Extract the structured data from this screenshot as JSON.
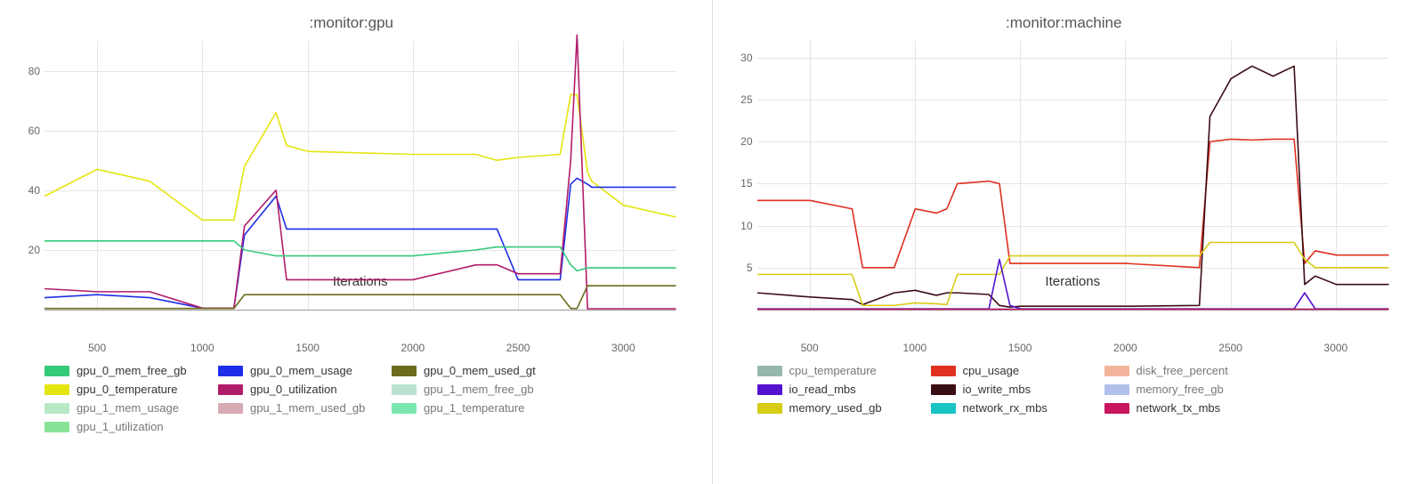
{
  "chart_data": [
    {
      "type": "line",
      "title": ":monitor:gpu",
      "xlabel": "Iterations",
      "ylabel": "",
      "xlim": [
        250,
        3250
      ],
      "ylim": [
        0,
        90
      ],
      "x": [
        250,
        500,
        750,
        1000,
        1150,
        1200,
        1350,
        1400,
        1500,
        2000,
        2300,
        2400,
        2500,
        2700,
        2750,
        2780,
        2830,
        2850,
        3000,
        3250
      ],
      "x_ticks": [
        500,
        1000,
        1500,
        2000,
        2500,
        3000
      ],
      "y_ticks": [
        20,
        40,
        60,
        80
      ],
      "legend_items": [
        {
          "name": "gpu_0_mem_free_gb",
          "color": "#35c97a",
          "active": true
        },
        {
          "name": "gpu_0_mem_usage",
          "color": "#1e2ee8",
          "active": true
        },
        {
          "name": "gpu_0_mem_used_gt",
          "color": "#6b6b1a",
          "active": true
        },
        {
          "name": "gpu_0_temperature",
          "color": "#e4e410",
          "active": true
        },
        {
          "name": "gpu_0_utilization",
          "color": "#b11c6a",
          "active": true
        },
        {
          "name": "gpu_1_mem_free_gb",
          "color": "#b8e2cf",
          "active": false
        },
        {
          "name": "gpu_1_mem_usage",
          "color": "#b8e8c5",
          "active": false
        },
        {
          "name": "gpu_1_mem_used_gb",
          "color": "#d8abb4",
          "active": false
        },
        {
          "name": "gpu_1_temperature",
          "color": "#7ce6b0",
          "active": false
        },
        {
          "name": "gpu_1_utilization",
          "color": "#88e396",
          "active": false
        }
      ],
      "series": [
        {
          "name": "gpu_0_temperature",
          "color": "#e4e410",
          "values": [
            38,
            47,
            43,
            30,
            30,
            48,
            66,
            55,
            53,
            52,
            52,
            50,
            51,
            52,
            72,
            72,
            46,
            43,
            35,
            31
          ]
        },
        {
          "name": "gpu_0_mem_usage",
          "color": "#1e2ee8",
          "values": [
            4,
            5,
            4,
            0.5,
            0.5,
            25,
            38,
            27,
            27,
            27,
            27,
            27,
            10,
            10,
            42,
            44,
            42,
            41,
            41,
            41
          ]
        },
        {
          "name": "gpu_0_utilization",
          "color": "#b11c6a",
          "values": [
            7,
            6,
            6,
            0.5,
            0.5,
            28,
            40,
            10,
            10,
            10,
            15,
            15,
            12,
            12,
            50,
            92,
            0.3,
            0.3,
            0.3,
            0.3
          ]
        },
        {
          "name": "gpu_0_mem_free_gb",
          "color": "#35c97a",
          "values": [
            23,
            23,
            23,
            23,
            23,
            20,
            18,
            18,
            18,
            18,
            20,
            21,
            21,
            21,
            15,
            13,
            14,
            14,
            14,
            14
          ]
        },
        {
          "name": "gpu_0_mem_used_gt",
          "color": "#6b6b1a",
          "values": [
            0.4,
            0.4,
            0.4,
            0.4,
            0.4,
            5,
            5,
            5,
            5,
            5,
            5,
            5,
            5,
            5,
            0.4,
            0.4,
            8,
            8,
            8,
            8
          ]
        }
      ]
    },
    {
      "type": "line",
      "title": ":monitor:machine",
      "xlabel": "Iterations",
      "ylabel": "",
      "xlim": [
        250,
        3250
      ],
      "ylim": [
        0,
        32
      ],
      "x": [
        250,
        500,
        700,
        750,
        900,
        1000,
        1100,
        1150,
        1200,
        1350,
        1400,
        1450,
        1500,
        2000,
        2350,
        2400,
        2500,
        2600,
        2700,
        2800,
        2850,
        2900,
        3000,
        3250
      ],
      "x_ticks": [
        500,
        1000,
        1500,
        2000,
        2500,
        3000
      ],
      "y_ticks": [
        5,
        10,
        15,
        20,
        25,
        30
      ],
      "legend_items": [
        {
          "name": "cpu_temperature",
          "color": "#96b7ab",
          "active": false
        },
        {
          "name": "cpu_usage",
          "color": "#e03020",
          "active": true
        },
        {
          "name": "disk_free_percent",
          "color": "#f2b49a",
          "active": false
        },
        {
          "name": "io_read_mbs",
          "color": "#5412d0",
          "active": true
        },
        {
          "name": "io_write_mbs",
          "color": "#3a0d14",
          "active": true
        },
        {
          "name": "memory_free_gb",
          "color": "#b1c0ea",
          "active": false
        },
        {
          "name": "memory_used_gb",
          "color": "#d7cc16",
          "active": true
        },
        {
          "name": "network_rx_mbs",
          "color": "#19c4c5",
          "active": true
        },
        {
          "name": "network_tx_mbs",
          "color": "#c8155e",
          "active": true
        }
      ],
      "series": [
        {
          "name": "cpu_usage",
          "color": "#e03020",
          "values": [
            13,
            13,
            12,
            5,
            5,
            12,
            11.5,
            12,
            15,
            15.3,
            15,
            5.5,
            5.5,
            5.5,
            5,
            20,
            20.3,
            20.2,
            20.3,
            20.3,
            5.5,
            7,
            6.5,
            6.5
          ]
        },
        {
          "name": "io_write_mbs",
          "color": "#3a0d14",
          "values": [
            2,
            1.5,
            1.2,
            0.6,
            2,
            2.3,
            1.7,
            2,
            2,
            1.8,
            0.5,
            0.3,
            0.4,
            0.4,
            0.5,
            23,
            27.5,
            29,
            27.8,
            29,
            3,
            4,
            3,
            3
          ]
        },
        {
          "name": "memory_used_gb",
          "color": "#d7cc16",
          "values": [
            4.2,
            4.2,
            4.2,
            0.5,
            0.5,
            0.8,
            0.7,
            0.6,
            4.2,
            4.2,
            4.2,
            6.4,
            6.4,
            6.4,
            6.4,
            8,
            8,
            8,
            8,
            8,
            6,
            5,
            5,
            5
          ]
        },
        {
          "name": "io_read_mbs",
          "color": "#5412d0",
          "values": [
            0.1,
            0.1,
            0.1,
            0.1,
            0.1,
            0.1,
            0.1,
            0.1,
            0.1,
            0.1,
            6,
            0.5,
            0.1,
            0.1,
            0.1,
            0.1,
            0.1,
            0.1,
            0.1,
            0.1,
            2,
            0.1,
            0.1,
            0.1
          ]
        },
        {
          "name": "network_rx_mbs",
          "color": "#19c4c5",
          "values": [
            0.05,
            0.05,
            0.05,
            0.05,
            0.05,
            0.05,
            0.05,
            0.05,
            0.05,
            0.05,
            0.05,
            0.05,
            0.05,
            0.05,
            0.05,
            0.05,
            0.05,
            0.05,
            0.05,
            0.05,
            0.05,
            0.05,
            0.05,
            0.05
          ]
        },
        {
          "name": "network_tx_mbs",
          "color": "#c8155e",
          "values": [
            0.05,
            0.05,
            0.05,
            0.05,
            0.05,
            0.05,
            0.05,
            0.05,
            0.05,
            0.05,
            0.05,
            0.05,
            0.05,
            0.05,
            0.05,
            0.05,
            0.05,
            0.05,
            0.05,
            0.05,
            0.05,
            0.05,
            0.05,
            0.05
          ]
        }
      ]
    }
  ]
}
